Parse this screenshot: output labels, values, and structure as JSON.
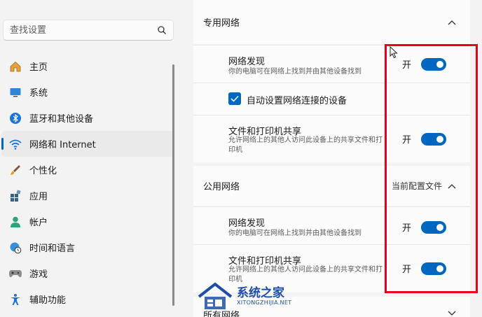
{
  "search": {
    "placeholder": "查找设置"
  },
  "sidebar": {
    "items": [
      {
        "label": "主页",
        "icon": "home-icon"
      },
      {
        "label": "系统",
        "icon": "system-icon"
      },
      {
        "label": "蓝牙和其他设备",
        "icon": "bluetooth-icon"
      },
      {
        "label": "网络和 Internet",
        "icon": "wifi-icon",
        "active": true
      },
      {
        "label": "个性化",
        "icon": "brush-icon"
      },
      {
        "label": "应用",
        "icon": "apps-icon"
      },
      {
        "label": "帐户",
        "icon": "account-icon"
      },
      {
        "label": "时间和语言",
        "icon": "globe-clock-icon"
      },
      {
        "label": "游戏",
        "icon": "gamepad-icon"
      },
      {
        "label": "辅助功能",
        "icon": "accessibility-icon"
      }
    ]
  },
  "private_network": {
    "title": "专用网络",
    "discovery": {
      "title": "网络发现",
      "desc": "你的电脑可在网络上找到并由其他设备找到",
      "state": "开"
    },
    "auto_setup": {
      "label": "自动设置网络连接的设备"
    },
    "sharing": {
      "title": "文件和打印机共享",
      "desc": "允许网络上的其他人访问此设备上的共享文件和打印机",
      "state": "开"
    }
  },
  "public_network": {
    "title": "公用网络",
    "badge": "当前配置文件",
    "discovery": {
      "title": "网络发现",
      "desc": "你的电脑可在网络上找到并由其他设备找到",
      "state": "开"
    },
    "sharing": {
      "title": "文件和打印机共享",
      "desc": "允许网络上的其他人访问此设备上的共享文件和打印机",
      "state": "开"
    }
  },
  "next_section": {
    "title": "所有网络"
  },
  "watermark": {
    "title": "系统之家",
    "sub": "XITONGZHIJIA.NET"
  },
  "colors": {
    "accent": "#0067c0",
    "highlight": "#e6001e"
  }
}
